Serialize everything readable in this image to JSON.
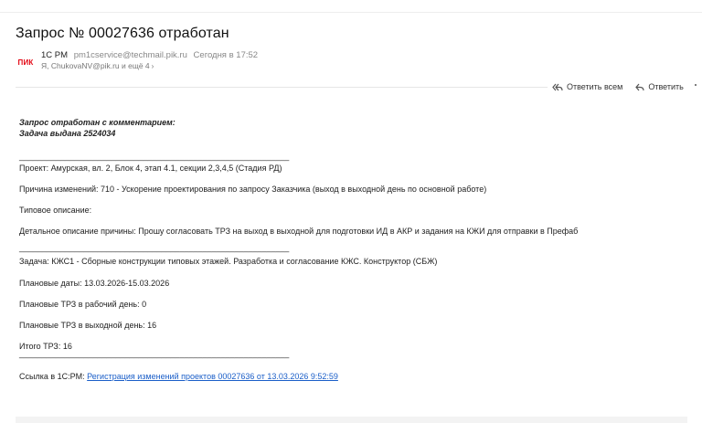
{
  "subject": "Запрос № 00027636 отработан",
  "sender": {
    "logo_text": "ПИК",
    "name": "1С PM",
    "email": "pm1cservice@techmail.pik.ru",
    "date": "Сегодня в 17:52",
    "recipients": "Я, ChukovaNV@pik.ru и ещё 4"
  },
  "actions": {
    "reply_all": "Ответить всем",
    "reply": "Ответить"
  },
  "body": {
    "head_line1": "Запрос отработан с комментарием:",
    "head_line2": "Задача выдана 2524034",
    "separator": "___________________________________________________________",
    "project": "Проект: Амурская, вл. 2, Блок 4, этап 4.1, секции 2,3,4,5 (Стадия РД)",
    "reason": "Причина изменений: 710 - Ускорение проектирования по запросу Заказчика (выход в выходной день по основной работе)",
    "typical": "Типовое описание:",
    "detailed": "Детальное описание причины: Прошу согласовать ТРЗ на выход в выходной для подготовки ИД в АКР и задания на КЖИ для отправки в Префаб",
    "task": "Задача: КЖС1 - Сборные конструкции типовых этажей. Разработка и согласование КЖС. Конструктор (СБЖ)",
    "planned_dates": "Плановые даты: 13.03.2026-15.03.2026",
    "trz_workday": "Плановые ТРЗ в рабочий день: 0",
    "trz_weekend": "Плановые ТРЗ в выходной день: 16",
    "trz_total": "Итого ТРЗ: 16",
    "link_prefix": "Ссылка в 1С:PM: ",
    "link_text": "Регистрация изменений проектов 00027636 от 13.03.2026 9:52:59"
  },
  "colors": {
    "link": "#1a5ec8",
    "logo": "#e30613"
  }
}
